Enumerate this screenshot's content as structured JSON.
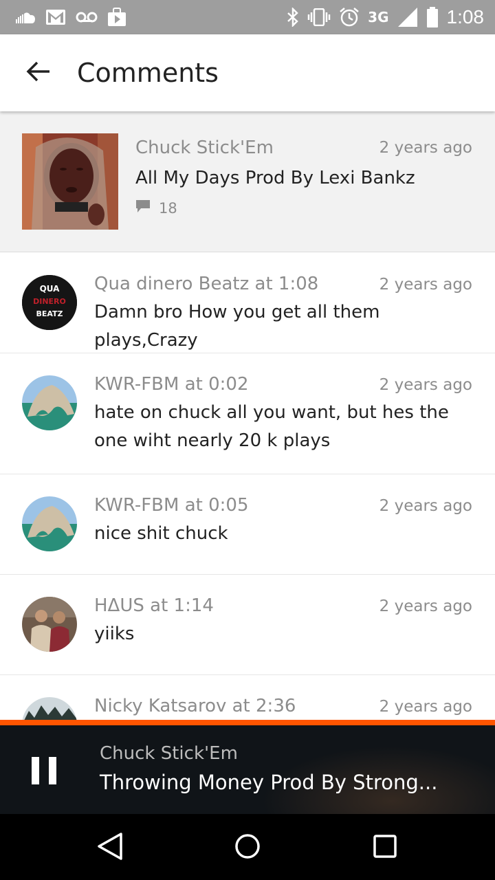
{
  "status_bar": {
    "network": "3G",
    "time": "1:08",
    "icons": [
      "soundcloud-icon",
      "gmail-icon",
      "voicemail-icon",
      "shopping-bag-icon",
      "bluetooth-icon",
      "vibrate-icon",
      "alarm-icon",
      "signal-icon",
      "battery-icon"
    ]
  },
  "app_bar": {
    "back_icon": "arrow-back-icon",
    "title": "Comments"
  },
  "track": {
    "user": "Chuck Stick'Em",
    "time_ago": "2 years ago",
    "title": "All My Days Prod By Lexi Bankz",
    "comment_icon": "comment-icon",
    "comment_count": "18"
  },
  "comments": [
    {
      "header": "Qua dinero Beatz at 1:08",
      "time_ago": "2 years ago",
      "body": "Damn bro How you get all them plays,Crazy",
      "avatar_text": [
        "QUA",
        "DINERO",
        "BEATZ"
      ]
    },
    {
      "header": "KWR-FBM at 0:02",
      "time_ago": "2 years ago",
      "body": "hate on chuck all you want, but hes the one wiht nearly 20 k plays"
    },
    {
      "header": "KWR-FBM at 0:05",
      "time_ago": "2 years ago",
      "body": "nice shit chuck"
    },
    {
      "header": "HΔUS at 1:14",
      "time_ago": "2 years ago",
      "body": "yiiks"
    },
    {
      "header": "Nicky Katsarov at 2:36",
      "time_ago": "2 years ago",
      "body": ""
    }
  ],
  "mini_player": {
    "user": "Chuck Stick'Em",
    "title": "Throwing Money Prod By Strong...",
    "accent_color": "#ff5500",
    "state_icon": "pause-icon"
  },
  "nav_bar": {
    "icons": [
      "back-triangle-icon",
      "home-circle-icon",
      "recents-square-icon"
    ]
  }
}
